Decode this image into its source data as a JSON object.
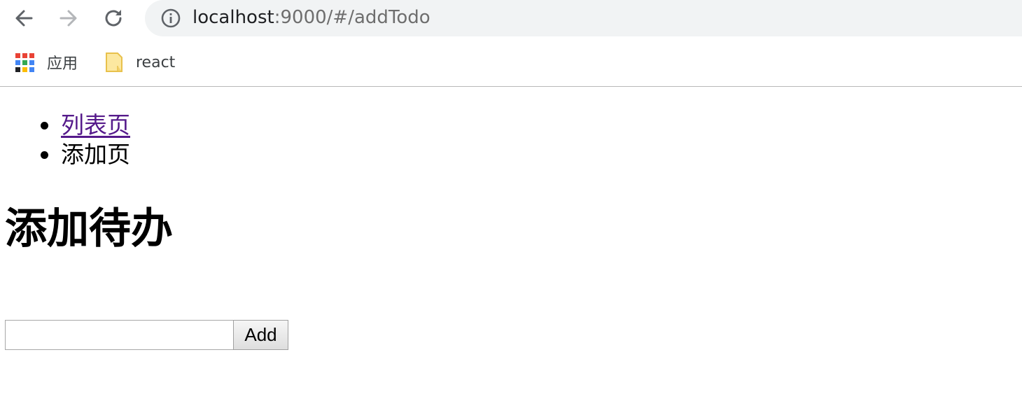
{
  "browser": {
    "url_host": "localhost",
    "url_rest": ":9000/#/addTodo",
    "bookmarks": [
      {
        "label": "应用",
        "icon": "apps-grid-icon"
      },
      {
        "label": "react",
        "icon": "folder-icon"
      }
    ],
    "colors": {
      "omnibox_bg": "#f1f3f4",
      "folder_fill": "#fce8a0",
      "folder_stroke": "#e8c14c"
    }
  },
  "nav": {
    "items": [
      {
        "label": "列表页",
        "is_link": true
      },
      {
        "label": "添加页",
        "is_link": false
      }
    ],
    "link_color": "#551a8b"
  },
  "heading": "添加待办",
  "form": {
    "input_value": "",
    "add_label": "Add"
  }
}
